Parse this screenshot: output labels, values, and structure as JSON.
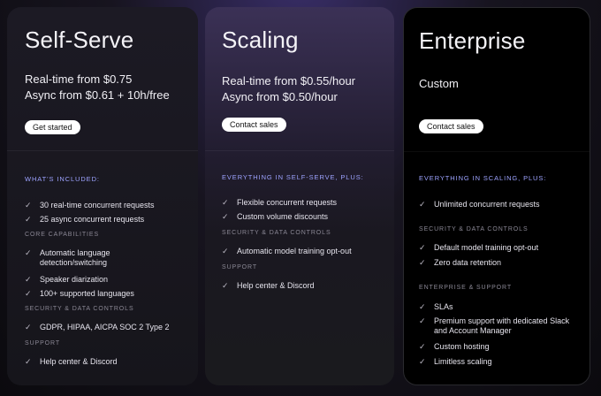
{
  "plans": [
    {
      "title": "Self-Serve",
      "price_lines": [
        "Real-time from $0.75",
        "Async from $0.61 + 10h/free"
      ],
      "button": "Get started",
      "sections": [
        {
          "heading": "WHAT'S INCLUDED:",
          "items": [
            "30 real-time concurrent requests",
            "25 async concurrent requests"
          ]
        },
        {
          "heading": "CORE CAPABILITIES",
          "items": [
            "Automatic language detection/switching",
            "Speaker diarization",
            "100+ supported languages"
          ]
        },
        {
          "heading": "SECURITY & DATA CONTROLS",
          "items": [
            "GDPR, HIPAA, AICPA SOC 2 Type 2"
          ]
        },
        {
          "heading": "SUPPORT",
          "items": [
            "Help center & Discord"
          ]
        }
      ]
    },
    {
      "title": "Scaling",
      "price_lines": [
        "Real-time from $0.55/hour",
        "Async from $0.50/hour"
      ],
      "button": "Contact sales",
      "sections": [
        {
          "heading": "EVERYTHING IN SELF-SERVE, PLUS:",
          "items": [
            "Flexible concurrent requests",
            "Custom volume discounts"
          ]
        },
        {
          "heading": "SECURITY & DATA CONTROLS",
          "items": [
            "Automatic model training opt-out"
          ]
        },
        {
          "heading": "SUPPORT",
          "items": [
            "Help center & Discord"
          ]
        }
      ]
    },
    {
      "title": "Enterprise",
      "price_lines": [
        "Custom"
      ],
      "button": "Contact sales",
      "sections": [
        {
          "heading": "EVERYTHING IN SCALING, PLUS:",
          "items": [
            "Unlimited concurrent requests"
          ]
        },
        {
          "heading": "SECURITY & DATA CONTROLS",
          "items": [
            "Default model training opt-out",
            "Zero data retention"
          ]
        },
        {
          "heading": "ENTERPRISE & SUPPORT",
          "items": [
            "SLAs",
            "Premium support with dedicated Slack and Account Manager",
            "Custom hosting",
            "Limitless scaling"
          ]
        }
      ]
    }
  ]
}
